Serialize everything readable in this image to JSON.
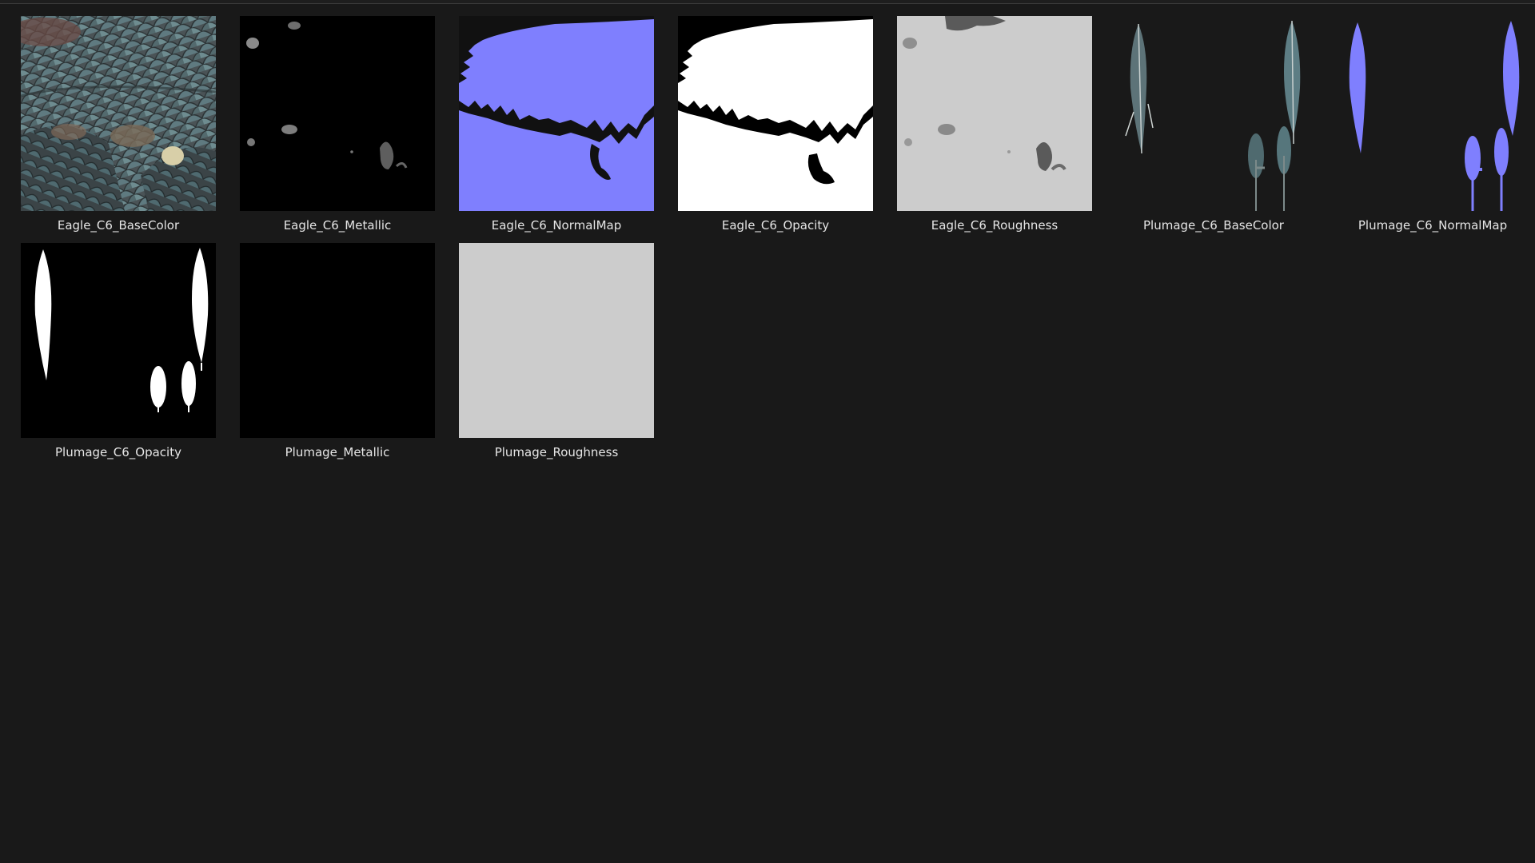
{
  "files": [
    {
      "name": "Eagle_C6_BaseColor",
      "icon": "eagle-basecolor-thumbnail"
    },
    {
      "name": "Eagle_C6_Metallic",
      "icon": "eagle-metallic-thumbnail"
    },
    {
      "name": "Eagle_C6_NormalMap",
      "icon": "eagle-normalmap-thumbnail"
    },
    {
      "name": "Eagle_C6_Opacity",
      "icon": "eagle-opacity-thumbnail"
    },
    {
      "name": "Eagle_C6_Roughness",
      "icon": "eagle-roughness-thumbnail"
    },
    {
      "name": "Plumage_C6_BaseColor",
      "icon": "plumage-basecolor-thumbnail"
    },
    {
      "name": "Plumage_C6_NormalMap",
      "icon": "plumage-normalmap-thumbnail"
    },
    {
      "name": "Plumage_C6_Opacity",
      "icon": "plumage-opacity-thumbnail"
    },
    {
      "name": "Plumage_Metallic",
      "icon": "plumage-metallic-thumbnail"
    },
    {
      "name": "Plumage_Roughness",
      "icon": "plumage-roughness-thumbnail"
    }
  ],
  "colors": {
    "background": "#191919",
    "normal_map_blue": "#7f7ffe",
    "roughness_gray": "#cccccc",
    "caption_text": "#e6e6e6"
  }
}
